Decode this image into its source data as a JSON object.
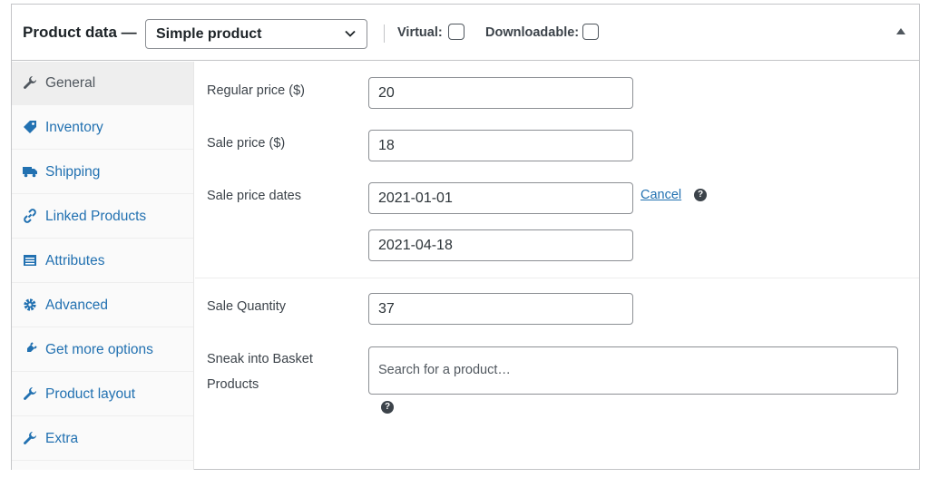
{
  "header": {
    "title": "Product data —",
    "product_type": "Simple product",
    "virtual_label": "Virtual:",
    "downloadable_label": "Downloadable:"
  },
  "tabs": [
    {
      "label": "General",
      "icon": "wrench-icon",
      "active": true
    },
    {
      "label": "Inventory",
      "icon": "tag-icon"
    },
    {
      "label": "Shipping",
      "icon": "truck-icon"
    },
    {
      "label": "Linked Products",
      "icon": "link-icon"
    },
    {
      "label": "Attributes",
      "icon": "list-icon"
    },
    {
      "label": "Advanced",
      "icon": "gear-icon"
    },
    {
      "label": "Get more options",
      "icon": "plugin-icon"
    },
    {
      "label": "Product layout",
      "icon": "wrench-icon"
    },
    {
      "label": "Extra",
      "icon": "wrench-icon"
    }
  ],
  "fields": {
    "regular_price": {
      "label": "Regular price ($)",
      "value": "20"
    },
    "sale_price": {
      "label": "Sale price ($)",
      "value": "18"
    },
    "sale_dates": {
      "label": "Sale price dates",
      "from": "2021-01-01",
      "to": "2021-04-18",
      "cancel": "Cancel"
    },
    "sale_quantity": {
      "label": "Sale Quantity",
      "value": "37"
    },
    "basket": {
      "label_line1": "Sneak into Basket",
      "label_line2": "Products",
      "placeholder": "Search for a product…"
    }
  },
  "help_glyph": "?",
  "colors": {
    "link": "#2271b1",
    "border": "#c3c4c7",
    "active_tab_bg": "#eeeeee"
  }
}
